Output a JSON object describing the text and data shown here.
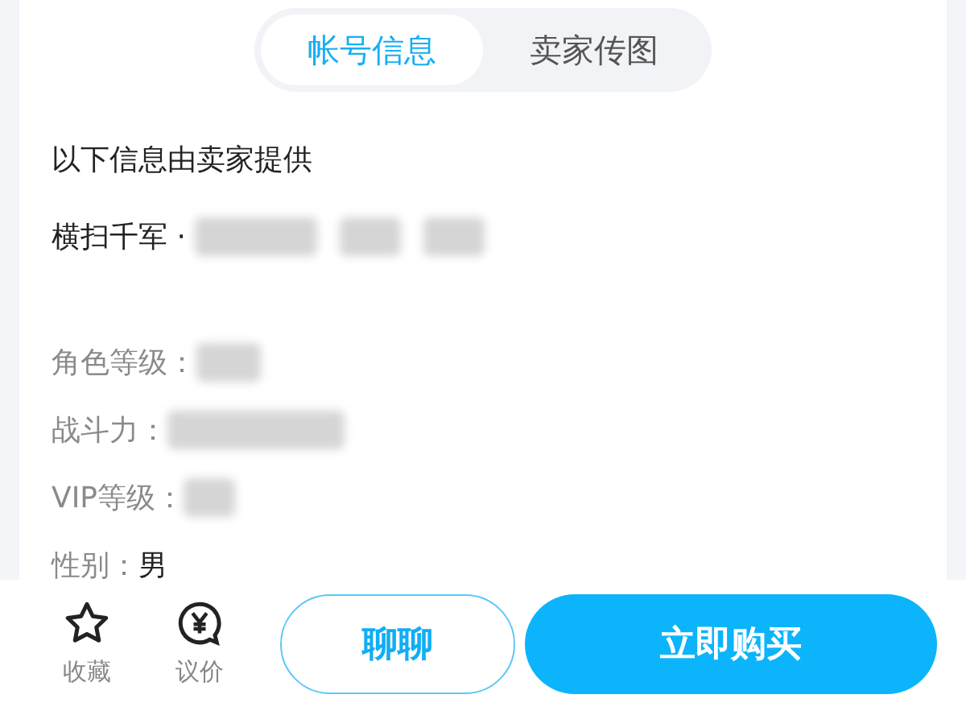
{
  "tabs": [
    {
      "label": "帐号信息",
      "selected": true
    },
    {
      "label": "卖家传图",
      "selected": false
    }
  ],
  "notice": "以下信息由卖家提供",
  "server": {
    "label": "横扫千军 ·"
  },
  "fields": [
    {
      "label": "角色等级：",
      "redacted": true
    },
    {
      "label": "战斗力：",
      "redacted": true
    },
    {
      "label": "VIP等级：",
      "redacted": true
    },
    {
      "label": "性别：",
      "value": "男",
      "redacted": false
    }
  ],
  "footer": {
    "actions": [
      {
        "label": "收藏",
        "kind": "star"
      },
      {
        "label": "议价",
        "kind": "price"
      }
    ],
    "chat_button": "聊聊",
    "buy_button": "立即购买"
  }
}
